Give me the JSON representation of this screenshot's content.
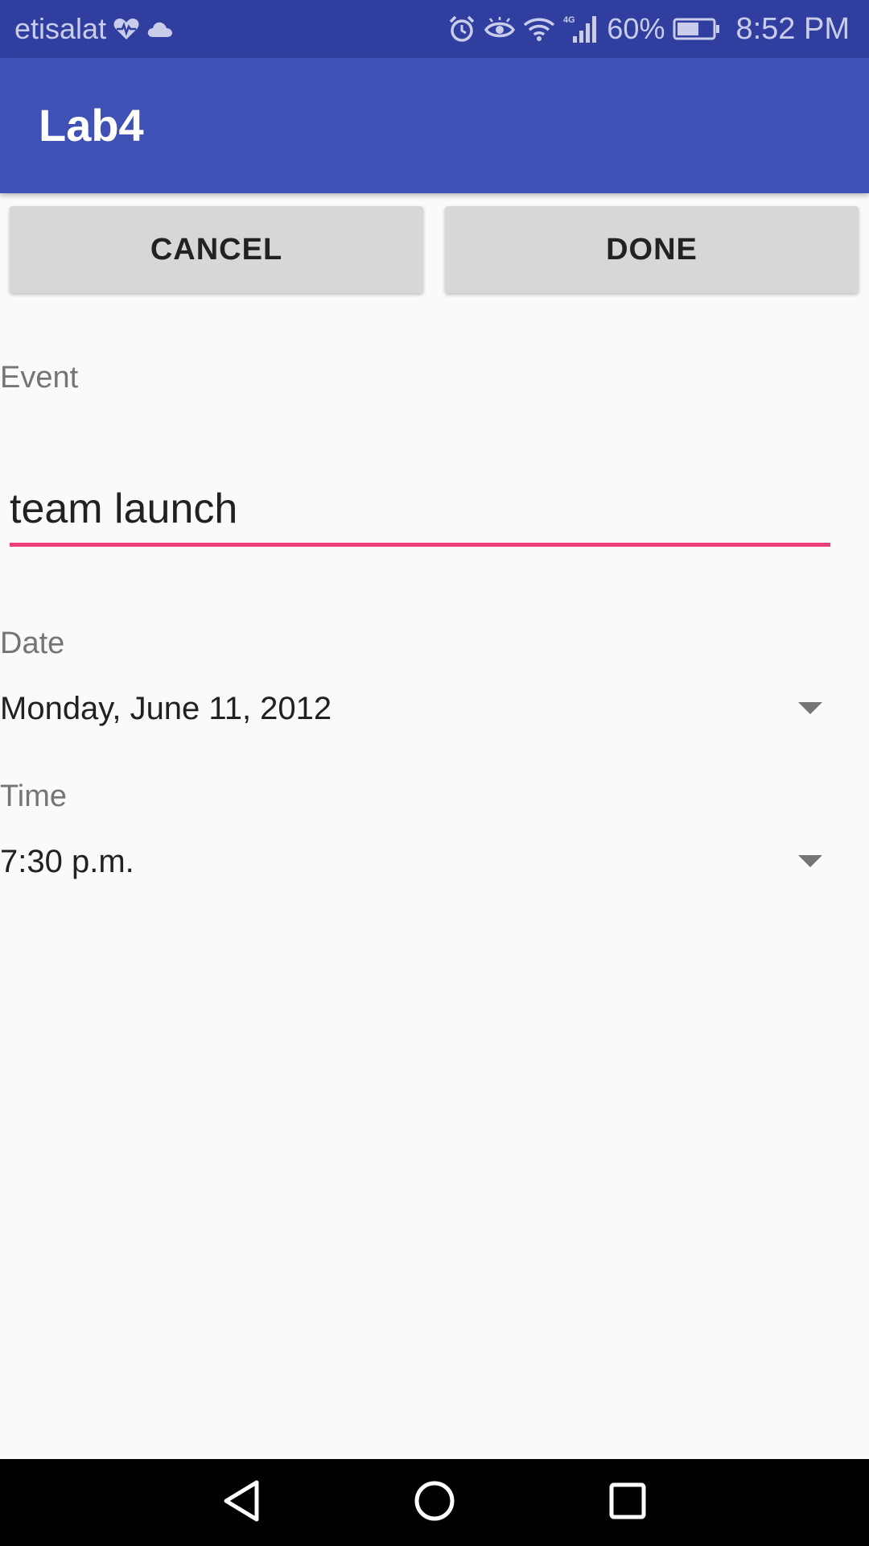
{
  "status_bar": {
    "carrier": "etisalat",
    "battery_percent": "60%",
    "time": "8:52 PM",
    "network_type": "4G",
    "icons": [
      "heart-monitor-icon",
      "cloud-icon",
      "alarm-icon",
      "eye-icon",
      "wifi-icon",
      "signal-icon",
      "battery-icon"
    ]
  },
  "action_bar": {
    "title": "Lab4"
  },
  "buttons": {
    "cancel_label": "CANCEL",
    "done_label": "DONE"
  },
  "form": {
    "event_label": "Event",
    "event_value": "team launch",
    "date_label": "Date",
    "date_value": "Monday, June 11, 2012",
    "time_label": "Time",
    "time_value": "7:30 p.m."
  },
  "colors": {
    "status_bar": "#303f9f",
    "primary": "#3f51b5",
    "accent": "#ec407a",
    "button_bg": "#d6d7d7",
    "background": "#fafafa"
  },
  "nav_bar": {
    "icons": [
      "back-icon",
      "home-icon",
      "recents-icon"
    ]
  }
}
